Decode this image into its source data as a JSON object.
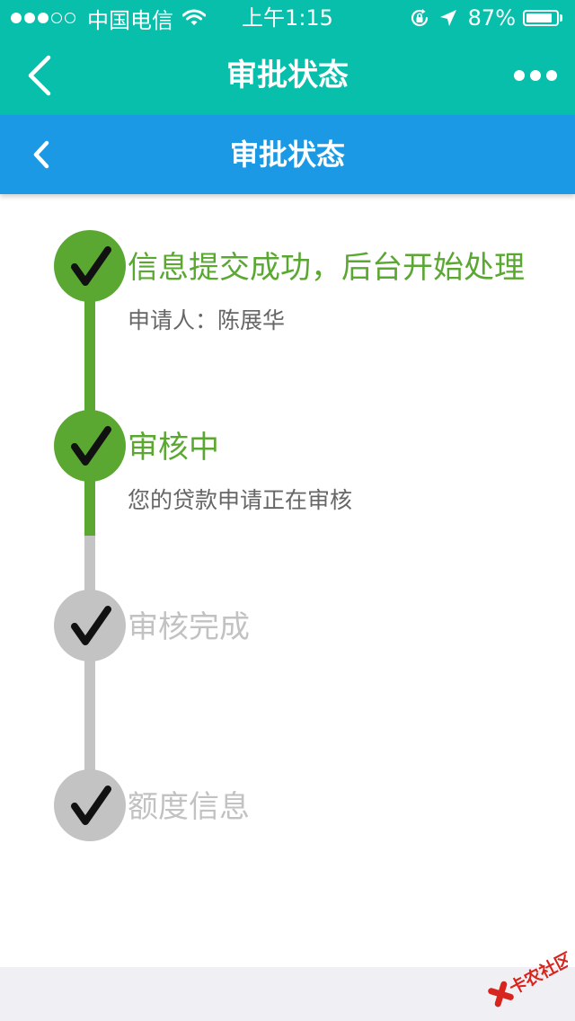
{
  "status_bar": {
    "carrier": "中国电信",
    "time": "上午1:15",
    "battery": "87%"
  },
  "nav": {
    "title": "审批状态"
  },
  "header": {
    "title": "审批状态"
  },
  "steps": [
    {
      "title": "信息提交成功，后台开始处理",
      "desc": "申请人：陈展华",
      "state": "done"
    },
    {
      "title": "审核中",
      "desc": "您的贷款申请正在审核",
      "state": "done"
    },
    {
      "title": "审核完成",
      "desc": "",
      "state": "pending"
    },
    {
      "title": "额度信息",
      "desc": "",
      "state": "pending"
    }
  ],
  "watermark": {
    "text": "卡农社区"
  },
  "colors": {
    "wechat_bar": "#08bfab",
    "header": "#1c99e5",
    "done": "#5aa832",
    "pending": "#c3c3c3",
    "watermark": "#d8241e"
  }
}
